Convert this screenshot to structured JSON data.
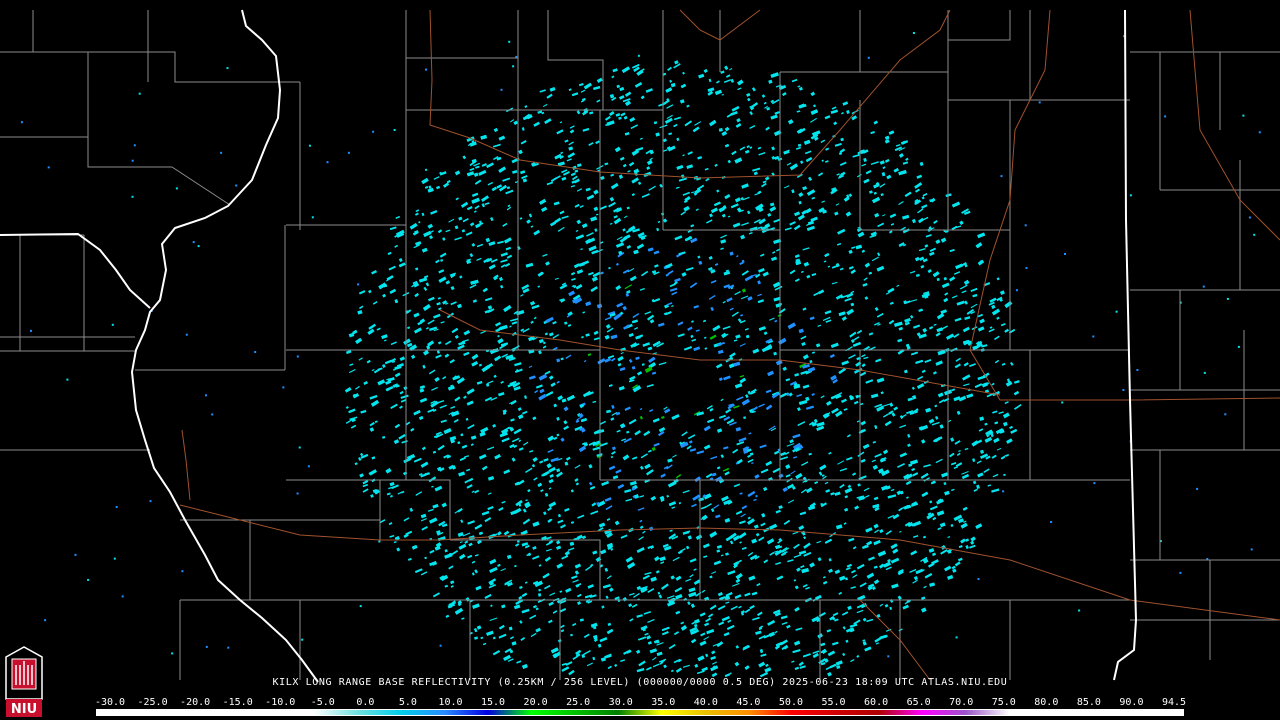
{
  "product": {
    "caption": "KILX LONG RANGE BASE REFLECTIVITY (0.25KM / 256 LEVEL) (000000/0000 0.5 DEG) 2025-06-23 18:09 UTC  ATLAS.NIU.EDU"
  },
  "logo": {
    "text": "NIU",
    "icon": "niu-tower-logo-icon",
    "color": "#c8102e"
  },
  "colorscale": {
    "labels": [
      "-30.0",
      "-25.0",
      "-20.0",
      "-15.0",
      "-10.0",
      "-5.0",
      "0.0",
      "5.0",
      "10.0",
      "15.0",
      "20.0",
      "25.0",
      "30.0",
      "35.0",
      "40.0",
      "45.0",
      "50.0",
      "55.0",
      "60.0",
      "65.0",
      "70.0",
      "75.0",
      "80.0",
      "85.0",
      "90.0",
      "94.5"
    ],
    "stops": [
      "#ffffff",
      "#ffffff",
      "#ffffff",
      "#ffffff",
      "#ffffff",
      "#ffffff",
      "#6fe0e0",
      "#00cfe8",
      "#2a8cff",
      "#0000e0",
      "#00ff00",
      "#00c000",
      "#008000",
      "#ffff00",
      "#e8c000",
      "#ff9000",
      "#ff0000",
      "#d00000",
      "#b00000",
      "#ff00ff",
      "#9a55c8",
      "#ffffff",
      "#ffffff",
      "#ffffff",
      "#ffffff",
      "#ffffff"
    ]
  },
  "colors": {
    "background": "#000000",
    "county_lines": "#8c8c8c",
    "state_lines": "#ffffff",
    "highways": "#a0522d",
    "echo_primary": "#00e5ee",
    "echo_secondary": "#1e90ff",
    "echo_strong": "#00c000"
  }
}
